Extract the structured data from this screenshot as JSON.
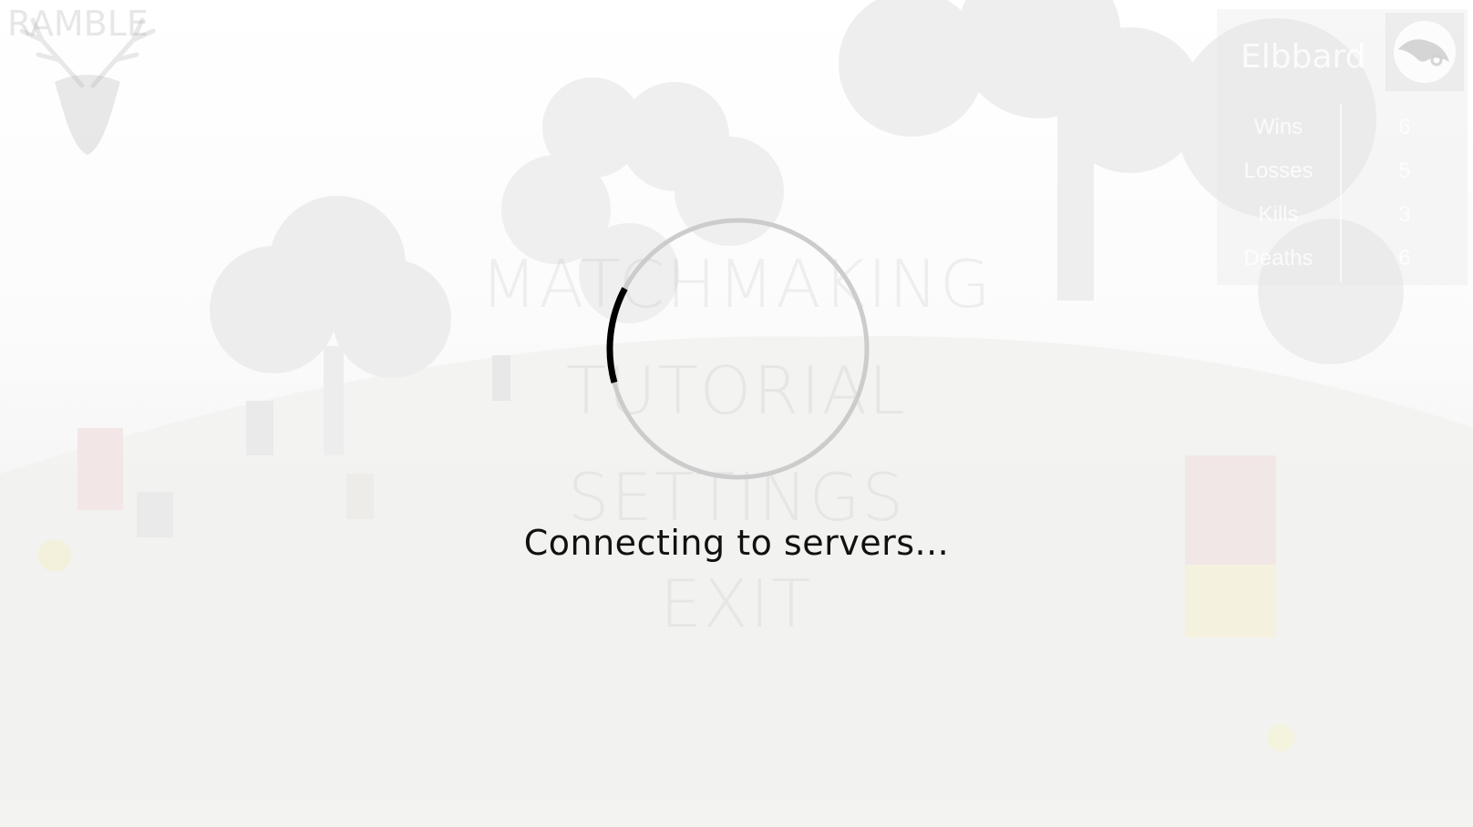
{
  "logo": {
    "text": "RAMBLE",
    "icon": "deer-head-icon"
  },
  "menu": {
    "items": [
      {
        "label": "MATCHMAKING"
      },
      {
        "label": "TUTORIAL"
      },
      {
        "label": "SETTINGS"
      },
      {
        "label": "EXIT"
      }
    ]
  },
  "profile": {
    "name": "Elbbard",
    "avatar_icon": "bird-head-icon",
    "stats": [
      {
        "label": "Wins",
        "value": "6"
      },
      {
        "label": "Losses",
        "value": "5"
      },
      {
        "label": "Kills",
        "value": "3"
      },
      {
        "label": "Deaths",
        "value": "6"
      }
    ]
  },
  "loading": {
    "text": "Connecting to servers...",
    "progress": 0.12,
    "spinner_icon": "loading-spinner-icon",
    "ring_color": "#cccccc",
    "arc_color": "#000000"
  }
}
